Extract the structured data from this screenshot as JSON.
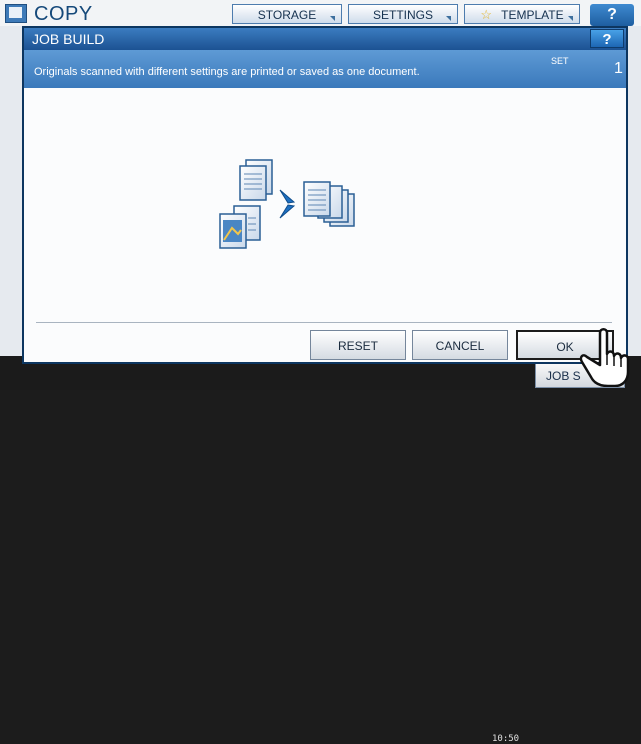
{
  "background": {
    "title": "COPY",
    "top_buttons": {
      "storage": "STORAGE",
      "settings": "SETTINGS",
      "template": "TEMPLATE"
    },
    "help_label": "?",
    "clock_date": "",
    "clock_time": "10:50",
    "job_status_label": "JOB S"
  },
  "dialog": {
    "title": "JOB BUILD",
    "help_label": "?",
    "message": "Originals scanned with different settings are printed or saved as one document.",
    "set_label": "SET",
    "set_value": "1",
    "buttons": {
      "reset": "RESET",
      "cancel": "CANCEL",
      "ok": "OK"
    }
  },
  "colors": {
    "title_bar": "#1c5293",
    "message_bar": "#4a89c8",
    "accent_arrow": "#1e70c1"
  }
}
